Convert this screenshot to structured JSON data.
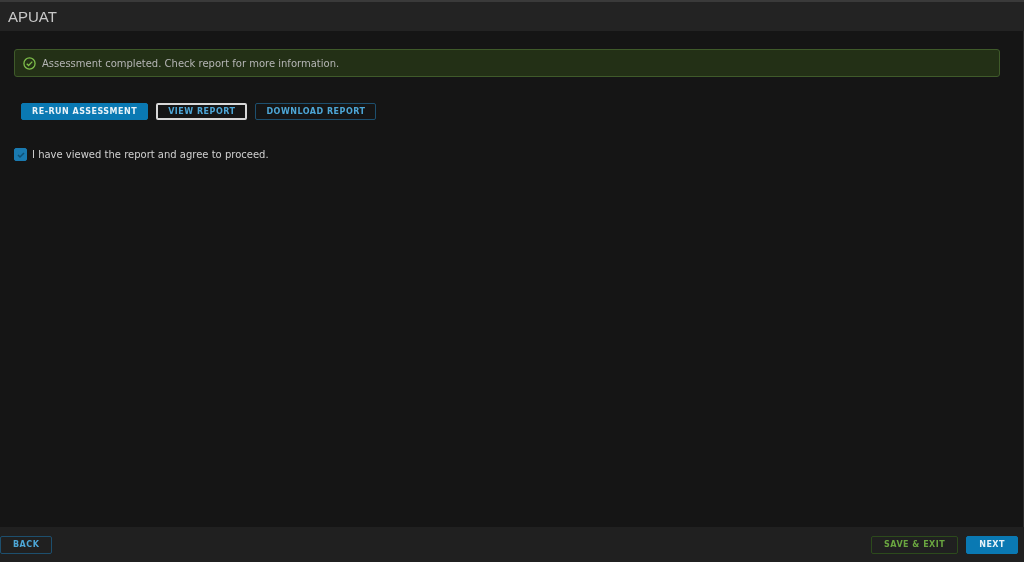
{
  "window": {
    "title": "APUAT"
  },
  "alert": {
    "kind": "success",
    "text": "Assessment completed. Check report for more information."
  },
  "actions": [
    {
      "label": "RE-RUN ASSESSMENT",
      "kind": "primary",
      "focused": false
    },
    {
      "label": "VIEW REPORT",
      "kind": "outline",
      "focused": true
    },
    {
      "label": "DOWNLOAD REPORT",
      "kind": "outline",
      "focused": false
    }
  ],
  "agreement": {
    "label": "I have viewed the report and agree to proceed.",
    "checked": true
  },
  "footer": {
    "left": [
      {
        "label": "BACK",
        "kind": "outline",
        "focused": false
      }
    ],
    "right": [
      {
        "label": "SAVE & EXIT",
        "kind": "success-outline",
        "focused": false
      },
      {
        "label": "NEXT",
        "kind": "primary",
        "focused": false
      }
    ]
  }
}
